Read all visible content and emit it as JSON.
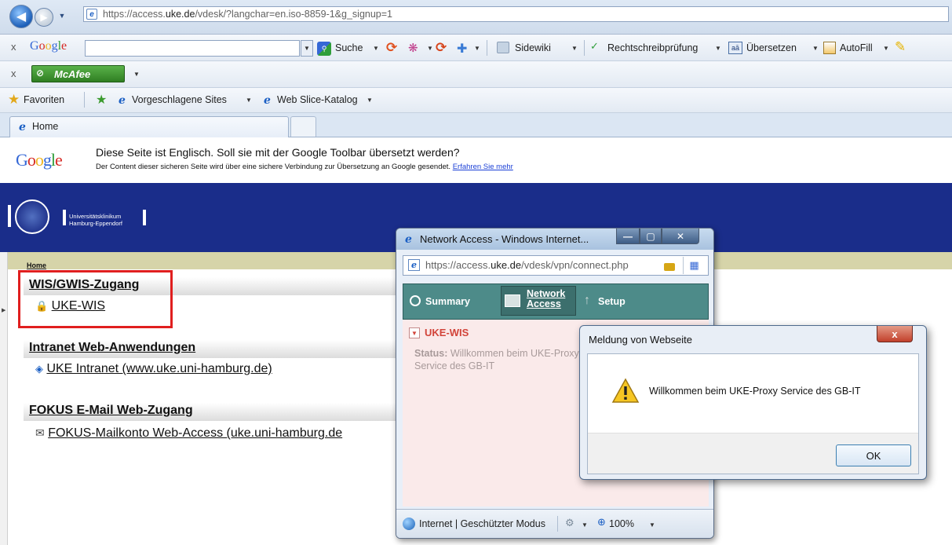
{
  "browser": {
    "url_prefix": "https://access.",
    "url_host": "uke.de",
    "url_path": "/vdesk/?langchar=en.iso-8859-1&g_signup=1",
    "tab_home": "Home"
  },
  "google_toolbar": {
    "close": "x",
    "logo": "Google",
    "search_label": "Suche",
    "sidewiki": "Sidewiki",
    "spell": "Rechtschreibprüfung",
    "translate": "Übersetzen",
    "autofill": "AutoFill"
  },
  "mcafee_toolbar": {
    "close": "x",
    "label": "McAfee"
  },
  "favorites_bar": {
    "favorites": "Favoriten",
    "suggested": "Vorgeschlagene Sites",
    "webslice": "Web Slice-Katalog"
  },
  "translate_bar": {
    "logo": "Google",
    "message": "Diese Seite ist Englisch. Soll sie mit der Google Toolbar übersetzt werden?",
    "sub": "Der Content dieser sicheren Seite wird über eine sichere Verbindung zur Übersetzung an Google gesendet.",
    "link": "Erfahren Sie mehr"
  },
  "page": {
    "brand_line1": "Universitätsklinikum",
    "brand_line2": "Hamburg-Eppendorf",
    "breadcrumb": "Home",
    "sections": [
      {
        "title": "WIS/GWIS-Zugang",
        "item": "UKE-WIS",
        "icon": "lock-icon"
      },
      {
        "title": "Intranet Web-Anwendungen",
        "item": "UKE Intranet (www.uke.uni-hamburg.de)",
        "icon": "web-page-icon"
      },
      {
        "title": "FOKUS E-Mail Web-Zugang",
        "item": "FOKUS-Mailkonto Web-Access (uke.uni-hamburg.de",
        "icon": "envelope-icon"
      }
    ]
  },
  "popup": {
    "title": "Network Access - Windows Internet...",
    "url_prefix": "https://access.",
    "url_host": "uke.de",
    "url_path": "/vdesk/vpn/connect.php",
    "nav": {
      "summary": "Summary",
      "network_line1": "Network",
      "network_line2": "Access",
      "setup": "Setup"
    },
    "resource": "UKE-WIS",
    "status_label": "Status:",
    "status_text": "Willkommen beim UKE-Proxy",
    "status_text2": "Service des GB-IT",
    "statusbar_zone": "Internet | Geschützter Modus",
    "zoom": "100%"
  },
  "dialog": {
    "title": "Meldung von Webseite",
    "message": "Willkommen beim UKE-Proxy Service des GB-IT",
    "ok": "OK",
    "close": "x"
  },
  "colors": {
    "banner": "#1a2d8a",
    "highlight": "#e01f1f",
    "nav_teal": "#4d8b89",
    "resource_red": "#d2443a"
  }
}
